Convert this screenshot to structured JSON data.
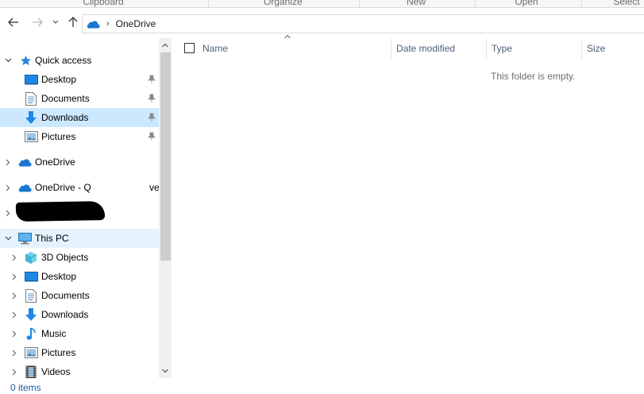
{
  "ribbon": {
    "groups": [
      "Clipboard",
      "Organize",
      "New",
      "Open",
      "Select"
    ]
  },
  "address": {
    "breadcrumb_separator": "›",
    "location": "OneDrive"
  },
  "nav": {
    "quick_access": "Quick access",
    "qa_items": [
      "Desktop",
      "Documents",
      "Downloads",
      "Pictures"
    ],
    "onedrive": "OneDrive",
    "onedrive_q": "OneDrive - Q",
    "onedrive_q_suffix": "ve",
    "this_pc": "This PC",
    "pc_items": [
      "3D Objects",
      "Desktop",
      "Documents",
      "Downloads",
      "Music",
      "Pictures",
      "Videos"
    ]
  },
  "content": {
    "columns": [
      "Name",
      "Date modified",
      "Type",
      "Size"
    ],
    "empty_message": "This folder is empty."
  },
  "status": {
    "items": "0 items"
  },
  "colors": {
    "selection": "#cce8ff",
    "hover": "#e5f3ff",
    "accent": "#1e5aa8",
    "folder_blue": "#1e88e5"
  }
}
